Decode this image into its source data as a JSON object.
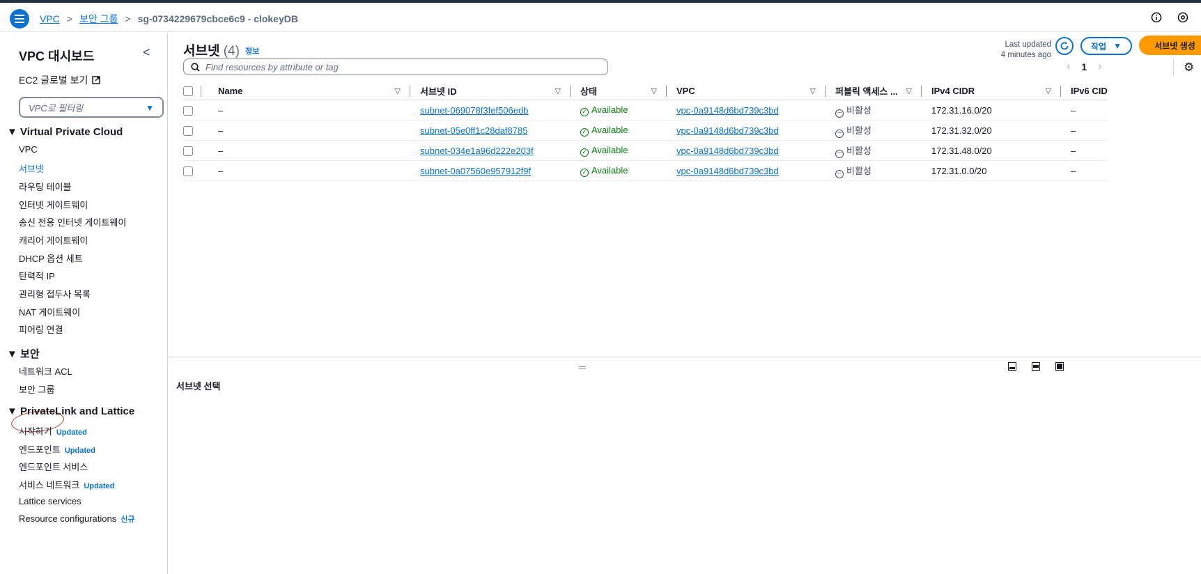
{
  "header": {
    "breadcrumbs": [
      "VPC",
      "보안 그룹",
      "sg-0734229679cbce6c9 - clokeyDB"
    ]
  },
  "sidebar": {
    "title": "VPC 대시보드",
    "ec2_global": "EC2 글로벌 보기",
    "filter_placeholder": "VPC로 필터링",
    "sections": [
      {
        "title": "Virtual Private Cloud",
        "items": [
          "VPC",
          "서브넷",
          "라우팅 테이블",
          "인터넷 게이트웨이",
          "송신 전용 인터넷 게이트웨이",
          "캐리어 게이트웨이",
          "DHCP 옵션 세트",
          "탄력적 IP",
          "관리형 접두사 목록",
          "NAT 게이트웨이",
          "피어링 연결"
        ]
      },
      {
        "title": "보안",
        "items": [
          "네트워크 ACL",
          "보안 그룹"
        ]
      },
      {
        "title": "PrivateLink and Lattice",
        "items": [
          {
            "label": "시작하기",
            "badge": "Updated"
          },
          {
            "label": "엔드포인트",
            "badge": "Updated"
          },
          {
            "label": "엔드포인트 서비스",
            "badge": ""
          },
          {
            "label": "서비스 네트워크",
            "badge": "Updated"
          },
          {
            "label": "Lattice services",
            "badge": ""
          },
          {
            "label": "Resource configurations",
            "badge": "신규"
          }
        ]
      }
    ]
  },
  "main": {
    "title": "서브넷",
    "count": "(4)",
    "info": "정보",
    "last_updated_1": "Last updated",
    "last_updated_2": "4 minutes ago",
    "actions_label": "작업",
    "create_label": "서브넷 생성",
    "search_placeholder": "Find resources by attribute or tag",
    "page": "1",
    "columns": [
      "Name",
      "서브넷 ID",
      "상태",
      "VPC",
      "퍼블릭 액세스 ...",
      "IPv4 CIDR",
      "IPv6 CID"
    ],
    "rows": [
      {
        "name": "–",
        "subnet_id": "subnet-069078f3fef506edb",
        "status": "Available",
        "vpc": "vpc-0a9148d6bd739c3bd",
        "public": "비활성",
        "ipv4": "172.31.16.0/20",
        "ipv6": "–"
      },
      {
        "name": "–",
        "subnet_id": "subnet-05e0ff1c28daf8785",
        "status": "Available",
        "vpc": "vpc-0a9148d6bd739c3bd",
        "public": "비활성",
        "ipv4": "172.31.32.0/20",
        "ipv6": "–"
      },
      {
        "name": "–",
        "subnet_id": "subnet-034e1a96d222e203f",
        "status": "Available",
        "vpc": "vpc-0a9148d6bd739c3bd",
        "public": "비활성",
        "ipv4": "172.31.48.0/20",
        "ipv6": "–"
      },
      {
        "name": "–",
        "subnet_id": "subnet-0a07560e957912f9f",
        "status": "Available",
        "vpc": "vpc-0a9148d6bd739c3bd",
        "public": "비활성",
        "ipv4": "172.31.0.0/20",
        "ipv6": "–"
      }
    ],
    "select_prompt": "서브넷 선택"
  }
}
